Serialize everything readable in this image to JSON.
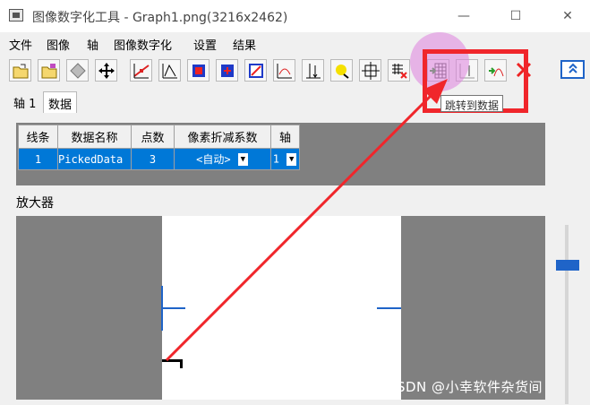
{
  "window": {
    "title": "图像数字化工具 - Graph1.png(3216x2462)"
  },
  "menu": [
    "文件",
    "图像",
    "轴",
    "图像数字化",
    "设置",
    "结果"
  ],
  "toolbar": {
    "icons": [
      "open-file-icon",
      "open-folder-icon",
      "transform-icon",
      "move-axes-icon",
      "digitize-line-icon",
      "edit-points-icon",
      "grid-icon-a",
      "grid-icon-b",
      "grid-icon-c",
      "chart-icon",
      "axis-marker-icon",
      "bubble-icon",
      "target-icon",
      "grid-delete-icon",
      "goto-data-icon",
      "curve-icon",
      "add-curve-icon",
      "delete-icon"
    ],
    "collapse_label": "≈"
  },
  "tooltip": "跳转到数据",
  "tabs": [
    "轴 1",
    "数据"
  ],
  "table": {
    "headers": [
      "线条",
      "数据名称",
      "点数",
      "像素折减系数",
      "轴"
    ],
    "row": [
      "1",
      "PickedData",
      "3",
      "<自动>",
      "1"
    ]
  },
  "magnifier_label": "放大器",
  "watermark": "CSDN @小幸软件杂货间",
  "colors": {
    "accent": "#1f64c8",
    "highlight": "#f0262b",
    "selection": "#0078d7"
  }
}
